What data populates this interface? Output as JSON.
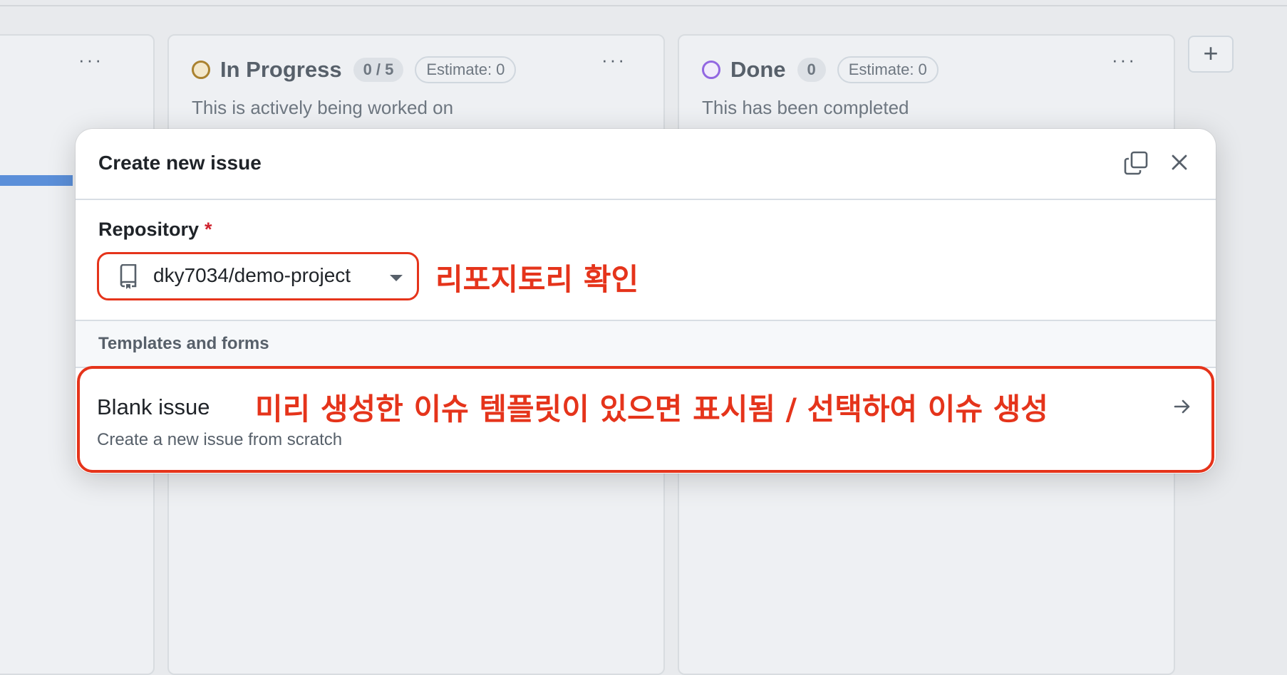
{
  "board": {
    "columns": [
      {
        "id": "left",
        "menu_glyph": "···"
      },
      {
        "id": "in_progress",
        "title": "In Progress",
        "count": "0 / 5",
        "estimate": "Estimate: 0",
        "description": "This is actively being worked on",
        "menu_glyph": "···",
        "status_color": "#9a6700"
      },
      {
        "id": "done",
        "title": "Done",
        "count": "0",
        "estimate": "Estimate: 0",
        "description": "This has been completed",
        "menu_glyph": "···",
        "status_color": "#8250df"
      }
    ],
    "add_column_glyph": "+"
  },
  "dialog": {
    "title": "Create new issue",
    "copy_icon": "copy-icon",
    "close_icon": "close-icon",
    "repository": {
      "label": "Repository",
      "required_mark": "*",
      "value": "dky7034/demo-project",
      "icon": "repo-icon"
    },
    "templates_label": "Templates and forms",
    "templates": [
      {
        "title": "Blank issue",
        "description": "Create a new issue from scratch",
        "icon": "arrow-right-icon"
      }
    ]
  },
  "annotations": {
    "repository_note": "리포지토리 확인",
    "template_note": "미리 생성한 이슈 템플릿이 있으면 표시됨 / 선택하여 이슈 생성",
    "highlight_color": "#e5341b"
  }
}
